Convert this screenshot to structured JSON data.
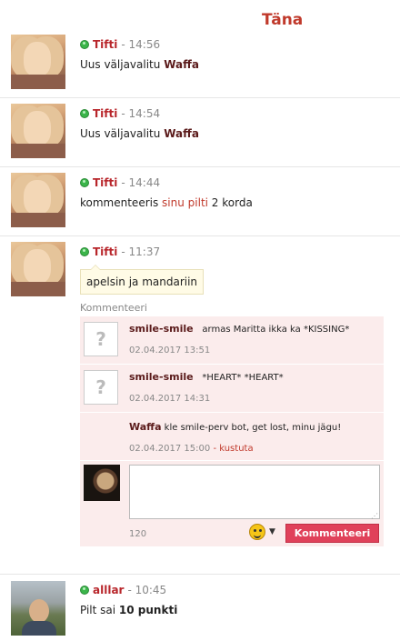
{
  "header": {
    "day_label": "Täna"
  },
  "entries": [
    {
      "user": "Tifti",
      "time": "- 14:56",
      "text_before": "Uus väljavalitu ",
      "highlight": "Waffa"
    },
    {
      "user": "Tifti",
      "time": "- 14:54",
      "text_before": "Uus väljavalitu ",
      "highlight": "Waffa"
    },
    {
      "user": "Tifti",
      "time": "- 14:44",
      "text_before": "kommenteeris ",
      "link": "sinu pilti",
      "text_after": " 2 korda"
    },
    {
      "user": "Tifti",
      "time": "- 11:37",
      "bubble": "apelsin ja mandariin",
      "comments_label": "Kommenteeri",
      "comments": [
        {
          "user": "smile-smile",
          "text": "armas Maritta ikka ka *KISSING*",
          "date": "02.04.2017 13:51"
        },
        {
          "user": "smile-smile",
          "text": "*HEART* *HEART*",
          "date": "02.04.2017 14:31"
        },
        {
          "user": "Waffa",
          "text": " kle smile-perv bot, get lost, minu jägu!",
          "date": "02.04.2017 15:00",
          "delete_label": "- kustuta"
        }
      ],
      "composer": {
        "char_count": "120",
        "submit_label": "Kommenteeri",
        "placeholder": ""
      }
    },
    {
      "user": "alllar",
      "time": "- 10:45",
      "text_before": "Pilt sai ",
      "highlight": "10 punkti"
    }
  ],
  "icons": [
    "online-icon",
    "smiley-icon",
    "caret-down-icon",
    "default-avatar-icon",
    "resize-icon"
  ],
  "colors": {
    "username": "#b8262b",
    "comments_bg": "#fbecec",
    "submit_bg": "#e0415a",
    "online": "#3bb54a",
    "day_header": "#c0392b"
  }
}
